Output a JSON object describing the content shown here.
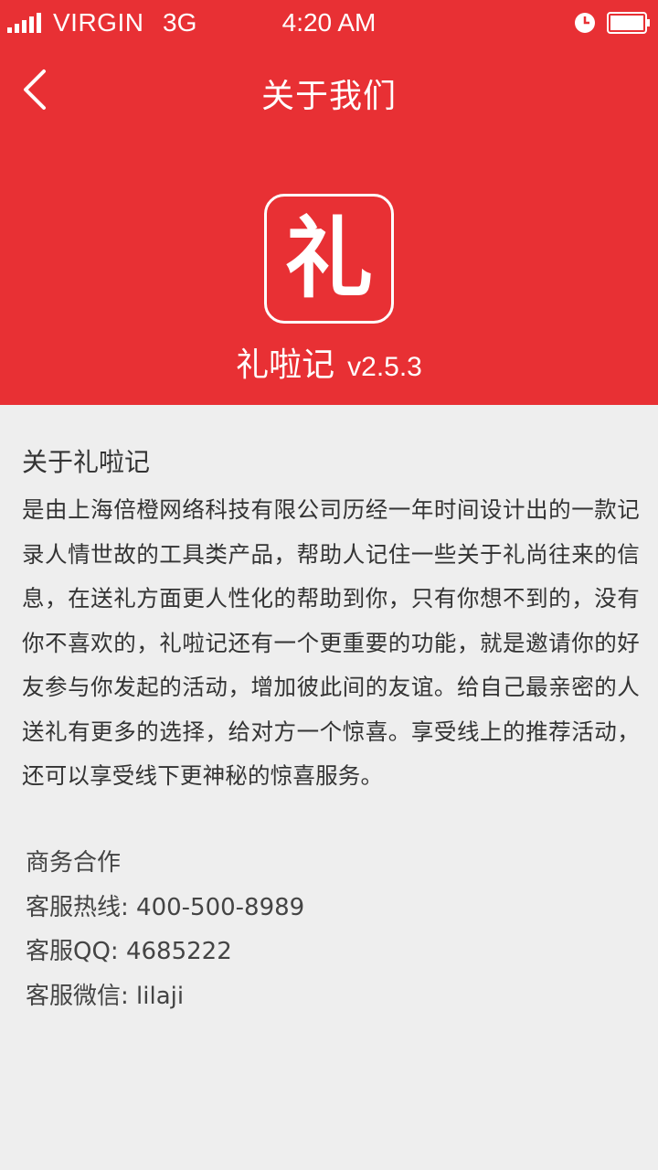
{
  "status_bar": {
    "carrier": "VIRGIN",
    "network": "3G",
    "time": "4:20 AM",
    "icons": [
      "signal-icon",
      "alarm-icon",
      "battery-icon"
    ]
  },
  "nav": {
    "back_icon": "chevron-left-icon",
    "title": "关于我们"
  },
  "app": {
    "logo_char": "礼",
    "name": "礼啦记",
    "version": "v2.5.3"
  },
  "about": {
    "title": "关于礼啦记",
    "body": "是由上海倍橙网络科技有限公司历经一年时间设计出的一款记录人情世故的工具类产品，帮助人记住一些关于礼尚往来的信息，在送礼方面更人性化的帮助到你，只有你想不到的，没有你不喜欢的，礼啦记还有一个更重要的功能，就是邀请你的好友参与你发起的活动，增加彼此间的友谊。给自己最亲密的人送礼有更多的选择，给对方一个惊喜。享受线上的推荐活动，还可以享受线下更神秘的惊喜服务。"
  },
  "contact": {
    "business": "商务合作",
    "hotline": "客服热线: 400-500-8989",
    "qq": "客服QQ: 4685222",
    "wechat": "客服微信: lilaji"
  },
  "colors": {
    "brand_red": "#e83034",
    "background": "#eeeeee",
    "text": "#333333"
  }
}
